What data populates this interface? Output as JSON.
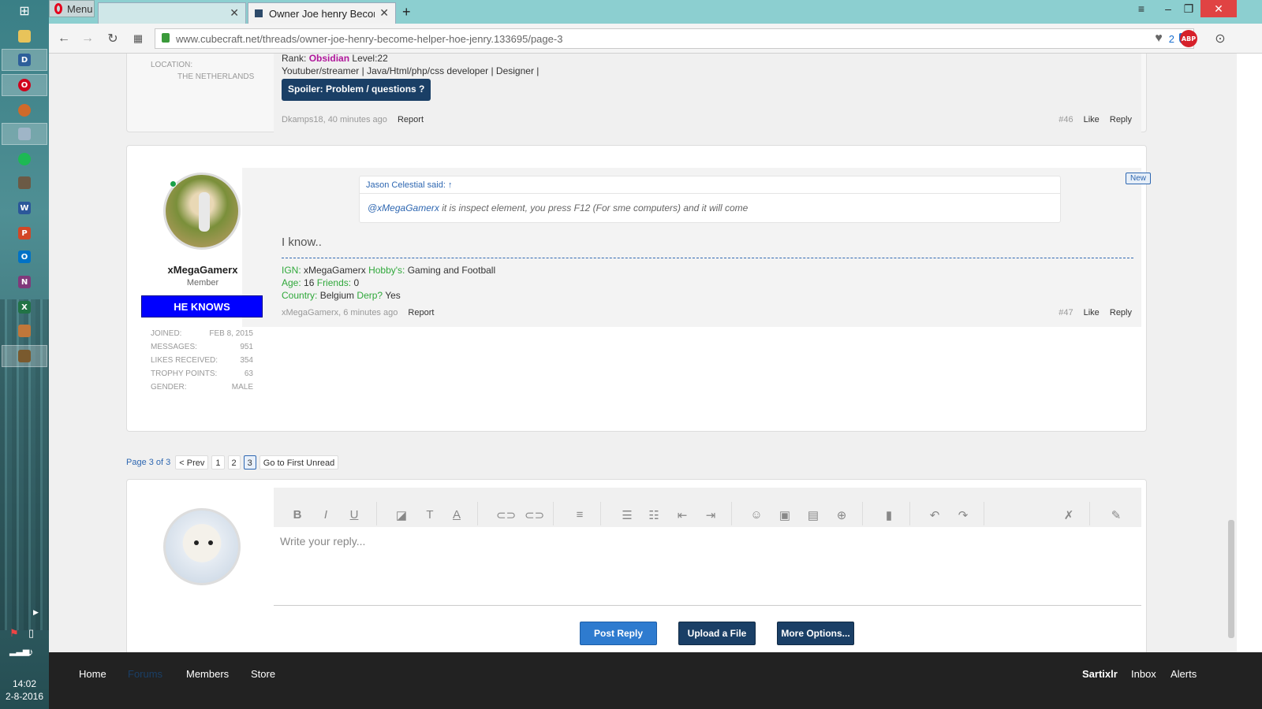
{
  "browser": {
    "menu_label": "Menu",
    "tabs": [
      {
        "title": ""
      },
      {
        "title": "Owner Joe henry Become"
      }
    ],
    "url": "www.cubecraft.net/threads/owner-joe-henry-become-helper-hoe-jenry.133695/page-3",
    "url_badge_count": "2",
    "abp_label": "ABP"
  },
  "taskbar": {
    "time": "14:02",
    "date": "2-8-2016"
  },
  "prev_post": {
    "location_label": "LOCATION:",
    "location_value": "THE NETHERLANDS",
    "rank_label": "Rank:",
    "rank_value": "Obsidian",
    "level": "Level:22",
    "roles": "Youtuber/streamer | Java/Html/php/css developer | Designer |",
    "spoiler_label": "Spoiler: Problem / questions ?",
    "meta": "Dkamps18, 40 minutes ago",
    "report": "Report",
    "number": "#46",
    "like": "Like",
    "reply": "Reply"
  },
  "post": {
    "username": "xMegaGamerx",
    "user_title": "Member",
    "banner": "HE KNOWS",
    "stats": [
      {
        "label": "Joined:",
        "value": "Feb 8, 2015"
      },
      {
        "label": "Messages:",
        "value": "951"
      },
      {
        "label": "Likes Received:",
        "value": "354"
      },
      {
        "label": "Trophy Points:",
        "value": "63"
      },
      {
        "label": "Gender:",
        "value": "Male"
      }
    ],
    "new_badge": "New",
    "quote_header": "Jason Celestial said: ↑",
    "quote_mention": "@xMegaGamerx",
    "quote_text": " it is inspect element, you press F12 (For sme computers) and it will come",
    "message": "I know..",
    "signature": {
      "ign_label": "IGN:",
      "ign_value": "xMegaGamerx",
      "hobby_label": "Hobby's:",
      "hobby_value": "Gaming and Football",
      "age_label": "Age:",
      "age_value": "16",
      "friends_label": "Friends:",
      "friends_value": "0",
      "country_label": "Country:",
      "country_value": "Belgium",
      "derp_label": "Derp?",
      "derp_value": "Yes"
    },
    "meta": "xMegaGamerx, 6 minutes ago",
    "report": "Report",
    "number": "#47",
    "like": "Like",
    "reply": "Reply"
  },
  "pagination": {
    "summary": "Page 3 of 3",
    "prev": "< Prev",
    "pages": [
      "1",
      "2",
      "3"
    ],
    "first_unread": "Go to First Unread"
  },
  "reply_box": {
    "placeholder": "Write your reply...",
    "post_button": "Post Reply",
    "upload_button": "Upload a File",
    "more_button": "More Options..."
  },
  "footer": {
    "nav": [
      "Home",
      "Forums",
      "Members",
      "Store"
    ],
    "user": "Sartixlr",
    "inbox": "Inbox",
    "alerts": "Alerts"
  },
  "colors": {
    "banner_bg": "#0000ff",
    "button_blue": "#2e7bcf",
    "button_navy": "#1a3f66",
    "rank_color": "#b0179b",
    "signature_green": "#2fa83a"
  }
}
